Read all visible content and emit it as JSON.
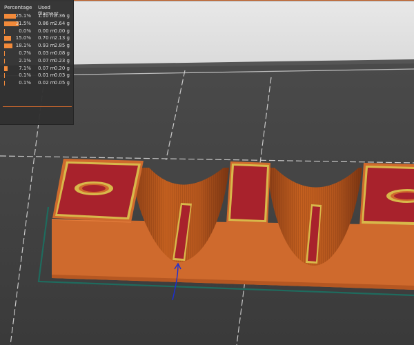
{
  "legend": {
    "header": {
      "percentage": "Percentage",
      "used_filament": "Used filament"
    },
    "rows": [
      {
        "percent": "25.1%",
        "length": "1.10 m",
        "weight": "3.36 g",
        "fraction": 0.251
      },
      {
        "percent": "31.5%",
        "length": "0.86 m",
        "weight": "2.64 g",
        "fraction": 0.315
      },
      {
        "percent": "0.0%",
        "length": "0.00 m",
        "weight": "0.00 g",
        "fraction": 0.0
      },
      {
        "percent": "15.0%",
        "length": "0.70 m",
        "weight": "2.13 g",
        "fraction": 0.15
      },
      {
        "percent": "18.1%",
        "length": "0.93 m",
        "weight": "2.85 g",
        "fraction": 0.181
      },
      {
        "percent": "0.7%",
        "length": "0.03 m",
        "weight": "0.08 g",
        "fraction": 0.007
      },
      {
        "percent": "2.1%",
        "length": "0.07 m",
        "weight": "0.23 g",
        "fraction": 0.021
      },
      {
        "percent": "7.1%",
        "length": "0.07 m",
        "weight": "0.20 g",
        "fraction": 0.071
      },
      {
        "percent": "0.1%",
        "length": "0.01 m",
        "weight": "0.03 g",
        "fraction": 0.001
      },
      {
        "percent": "0.1%",
        "length": "0.02 m",
        "weight": "0.05 g",
        "fraction": 0.001
      }
    ]
  },
  "colors": {
    "accent_orange": "#f28a3a",
    "model_orange": "#cf6a2d",
    "top_surface_red": "#a8222c",
    "perimeter_yellow": "#d8b84a",
    "skirt_teal": "#1f6b5e",
    "travel_blue": "#1a2fd6"
  }
}
